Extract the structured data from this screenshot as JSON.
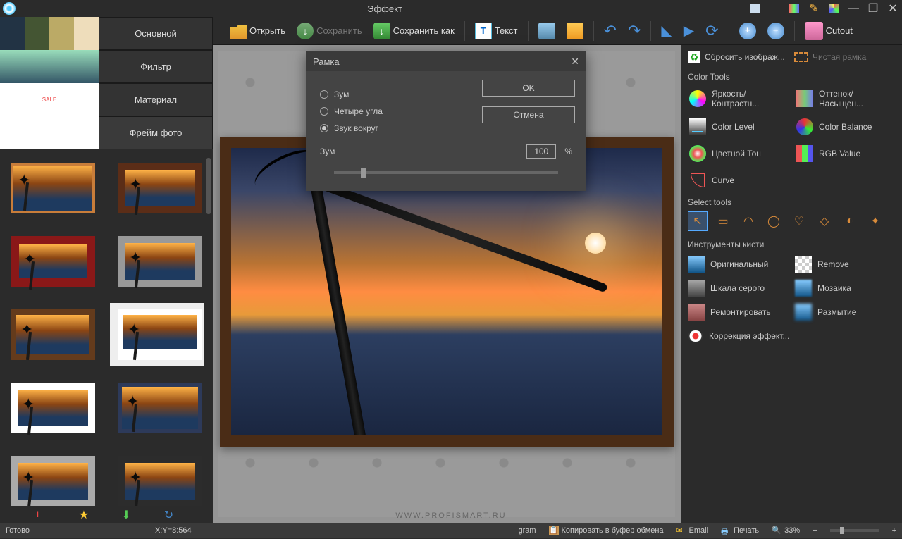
{
  "titlebar": {
    "title": "Эффект"
  },
  "toolbar": {
    "open": "Открыть",
    "save": "Сохранить",
    "saveAs": "Сохранить как",
    "text": "Текст",
    "cutout": "Cutout"
  },
  "leftCats": {
    "main": "Основной",
    "filter": "Фильтр",
    "material": "Материал",
    "framePhoto": "Фрейм фото"
  },
  "dialog": {
    "title": "Рамка",
    "optZoom": "Зум",
    "optFourCorners": "Четыре угла",
    "optSoundAround": "Звук вокруг",
    "zoomLabel": "Зум",
    "zoomValue": "100",
    "zoomPercent": "%",
    "ok": "OK",
    "cancel": "Отмена"
  },
  "right": {
    "reset": "Сбросить изображ...",
    "cleanFrame": "Чистая рамка",
    "colorTools": "Color Tools",
    "brightness": "Яркость/Контрастн...",
    "hue": "Оттенок/Насыщен...",
    "colorLevel": "Color Level",
    "colorBalance": "Color Balance",
    "colorTone": "Цветной Тон",
    "rgbValue": "RGB Value",
    "curve": "Curve",
    "selectTools": "Select tools",
    "brushTools": "Инструменты кисти",
    "bOriginal": "Оригинальный",
    "bRemove": "Remove",
    "bGray": "Шкала серого",
    "bMosaic": "Мозаика",
    "bRepair": "Ремонтировать",
    "bBlur": "Размытие",
    "effectCorrection": "Коррекция эффект..."
  },
  "status": {
    "ready": "Готово",
    "coords": "X:Y=8:564",
    "watermark": "WWW.PROFISMART.RU",
    "program": "gram",
    "copyClipboard": "Копировать в буфер обмена",
    "email": "Email",
    "print": "Печать",
    "zoom": "33%"
  }
}
